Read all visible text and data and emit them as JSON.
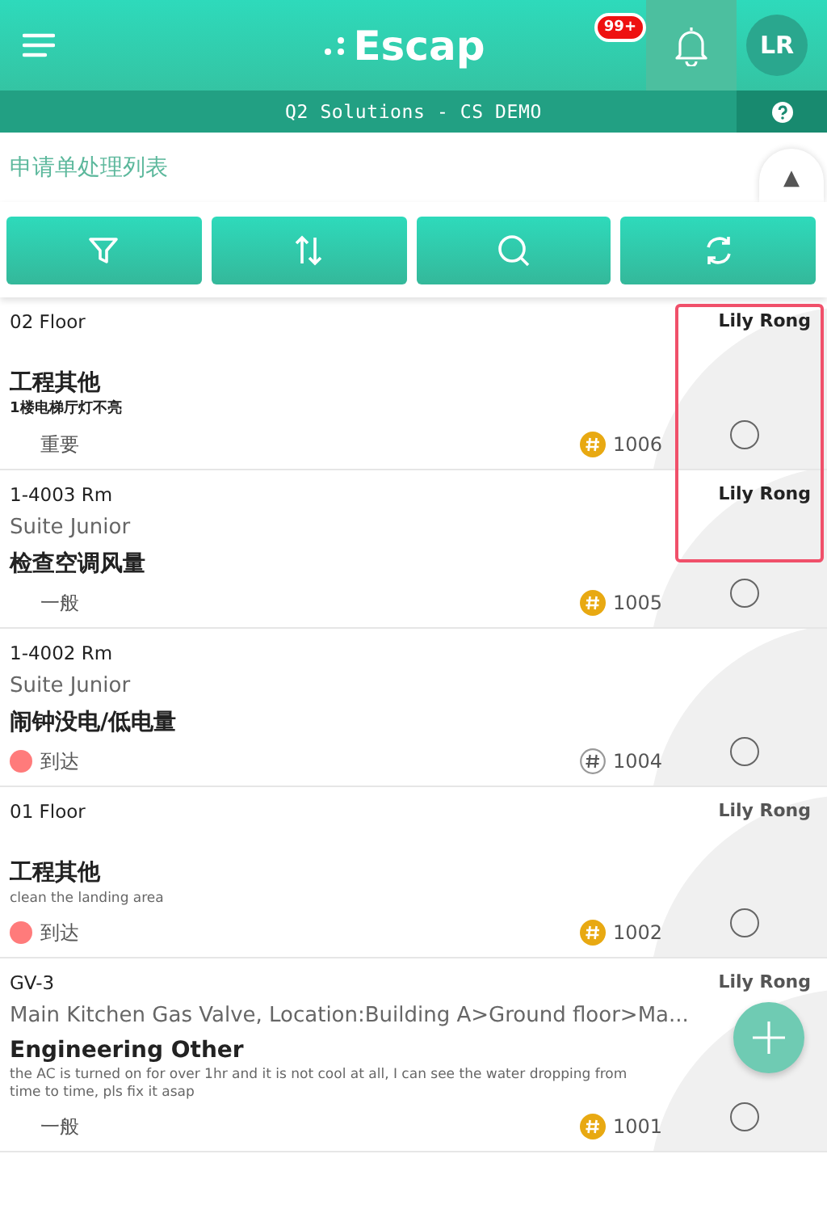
{
  "header": {
    "logo": "Escap",
    "badge": "99+",
    "avatar": "LR"
  },
  "subbar": {
    "title": "Q2 Solutions - CS DEMO"
  },
  "page_title": "申请单处理列表",
  "collapse": "▲",
  "requests": [
    {
      "location": "02 Floor",
      "assignee": "Lily Rong",
      "category": "工程其他",
      "description": "1楼电梯厅灯不亮",
      "desc_bold": true,
      "priority": "重要",
      "number": "1006",
      "number_filled": true,
      "checked": false,
      "highlighted": true
    },
    {
      "location": "1-4003 Rm",
      "assignee": "Lily Rong",
      "subtitle": "Suite Junior",
      "category": "检查空调风量",
      "priority": "一般",
      "number": "1005",
      "number_filled": true,
      "checked": false,
      "highlighted": true
    },
    {
      "location": "1-4002 Rm",
      "subtitle": "Suite Junior",
      "category": "闹钟没电/低电量",
      "priority": "到达",
      "color": "#ff7b7b",
      "number": "1004",
      "number_filled": false,
      "checked": false,
      "highlighted": false
    },
    {
      "location": "01 Floor",
      "assignee": "Lily Rong",
      "category": "工程其他",
      "description": "clean the landing area",
      "desc_bold": false,
      "priority": "到达",
      "color": "#ff7b7b",
      "number": "1002",
      "number_filled": true,
      "checked": false,
      "highlighted": false
    },
    {
      "location": "GV-3",
      "assignee": "Lily Rong",
      "subtitle": "Main Kitchen Gas Valve, Location:Building A>Ground floor>Ma...",
      "category": "Engineering Other",
      "description": "the AC is turned on for over 1hr and it is not cool at all, I can see the water dropping from time to time, pls fix it asap",
      "desc_bold": false,
      "priority": "一般",
      "number": "1001",
      "number_filled": true,
      "checked": false,
      "highlighted": false
    }
  ]
}
